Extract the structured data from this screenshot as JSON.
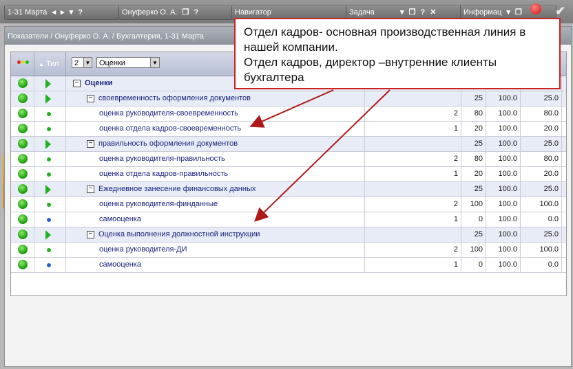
{
  "toolbar": {
    "period": "1-31 Марта",
    "person": "Онуферко О. А.",
    "navigator": "Навигатор",
    "task": "Задача",
    "info": "Информац"
  },
  "breadcrumb": "Показатели / Онуферко О. А. / Бухгалтерия, 1-31 Марта",
  "grid": {
    "type_header": "Тип",
    "level_value": "2",
    "view_value": "Оценки"
  },
  "rows": [
    {
      "label": "Оценки",
      "level": 0,
      "kind": "root",
      "c1": "",
      "c2": "",
      "c3": "",
      "c4": ""
    },
    {
      "label": "своевременность оформления документов",
      "level": 1,
      "kind": "group",
      "c1": "",
      "c2": "25",
      "c3": "100.0",
      "c4": "25.0"
    },
    {
      "label": "оценка руководителя-своевременность",
      "level": 2,
      "kind": "item",
      "dot": "green",
      "c1": "2",
      "c2": "80",
      "c3": "100.0",
      "c4": "80.0"
    },
    {
      "label": "оценка отдела кадров-своевременность",
      "level": 2,
      "kind": "item",
      "dot": "green",
      "c1": "1",
      "c2": "20",
      "c3": "100.0",
      "c4": "20.0"
    },
    {
      "label": "правильность оформления документов",
      "level": 1,
      "kind": "group",
      "c1": "",
      "c2": "25",
      "c3": "100.0",
      "c4": "25.0"
    },
    {
      "label": "оценка руководителя-правильность",
      "level": 2,
      "kind": "item",
      "dot": "green",
      "c1": "2",
      "c2": "80",
      "c3": "100.0",
      "c4": "80.0"
    },
    {
      "label": "оценка отдела кадров-правильность",
      "level": 2,
      "kind": "item",
      "dot": "green",
      "c1": "1",
      "c2": "20",
      "c3": "100.0",
      "c4": "20.0"
    },
    {
      "label": "Ежедневное занесение финансовых данных",
      "level": 1,
      "kind": "group",
      "c1": "",
      "c2": "25",
      "c3": "100.0",
      "c4": "25.0"
    },
    {
      "label": "оценка руководителя-финданные",
      "level": 2,
      "kind": "item",
      "dot": "green",
      "c1": "2",
      "c2": "100",
      "c3": "100.0",
      "c4": "100.0"
    },
    {
      "label": "самооценка",
      "level": 2,
      "kind": "item",
      "dot": "blue",
      "c1": "1",
      "c2": "0",
      "c3": "100.0",
      "c4": "0.0"
    },
    {
      "label": "Оценка выполнения должностной инструкции",
      "level": 1,
      "kind": "group",
      "c1": "",
      "c2": "25",
      "c3": "100.0",
      "c4": "25.0"
    },
    {
      "label": "оценка руководителя-ДИ",
      "level": 2,
      "kind": "item",
      "dot": "green",
      "c1": "2",
      "c2": "100",
      "c3": "100.0",
      "c4": "100.0"
    },
    {
      "label": "самооценка",
      "level": 2,
      "kind": "item",
      "dot": "blue",
      "c1": "1",
      "c2": "0",
      "c3": "100.0",
      "c4": "0.0"
    }
  ],
  "callout": {
    "line1": "Отдел кадров- основная производственная линия в нашей компании.",
    "line2": "Отдел кадров, директор –внутренние клиенты бухгалтера"
  }
}
